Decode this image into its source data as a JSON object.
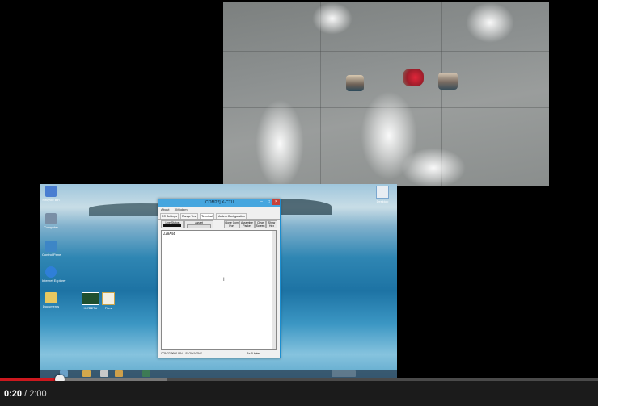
{
  "player": {
    "current_time": "0:20",
    "separator": " / ",
    "duration": "2:00",
    "progress_fraction": 0.1,
    "buffered_fraction": 0.28,
    "played_color": "#cc181e"
  },
  "desktop_icons": [
    {
      "label": "Recycle Bin",
      "icon": "recycle-bin-icon"
    },
    {
      "label": "Computer",
      "icon": "computer-icon"
    },
    {
      "label": "Control Panel",
      "icon": "control-panel-icon"
    },
    {
      "label": "Internet Explorer",
      "icon": "internet-explorer-icon"
    },
    {
      "label": "Documents",
      "icon": "documents-icon"
    },
    {
      "label": "XCTU",
      "icon": "xctu-icon"
    },
    {
      "label": "XCTU",
      "icon": "xctu-icon"
    },
    {
      "label": "Files",
      "icon": "file-icon"
    },
    {
      "label": "Desktop",
      "icon": "file-icon"
    }
  ],
  "app": {
    "title": "[COM22] X-CTU",
    "menu": [
      "About",
      "XModem"
    ],
    "tabs": [
      "PC Settings",
      "Range Test",
      "Terminal",
      "Modem Configuration"
    ],
    "active_tab": "Terminal",
    "toolbar": [
      {
        "label": "Line Status"
      },
      {
        "label": "Assert"
      },
      {
        "label": "Close Com Port"
      },
      {
        "label": "Assemble Packet"
      },
      {
        "label": "Clear Screen"
      },
      {
        "label": "Show Hex"
      }
    ],
    "terminal_text": "ZZ8A44",
    "status": "COM22   9600 8-N-1  FLOW:NONE",
    "status_right": "Rx: 5 bytes"
  },
  "colors": {
    "titlebar": "#46a6df",
    "controls_bg": "#1b1b1b"
  }
}
